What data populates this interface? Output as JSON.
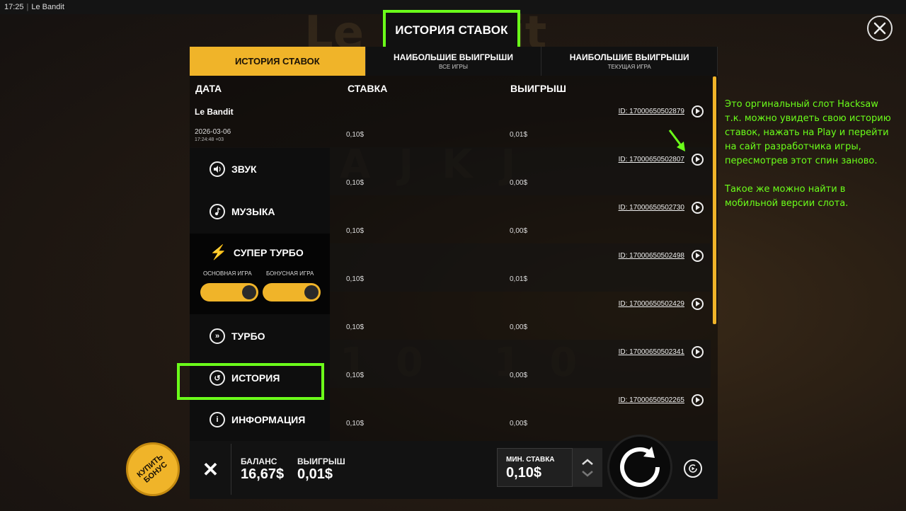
{
  "window": {
    "time": "17:25",
    "title": "Le Bandit"
  },
  "overlay_title": "ИСТОРИЯ СТАВОК",
  "tabs": [
    {
      "label": "ИСТОРИЯ СТАВОК",
      "sub": "",
      "active": true
    },
    {
      "label": "НАИБОЛЬШИЕ ВЫИГРЫШИ",
      "sub": "ВСЕ ИГРЫ",
      "active": false
    },
    {
      "label": "НАИБОЛЬШИЕ ВЫИГРЫШИ",
      "sub": "ТЕКУЩАЯ ИГРА",
      "active": false
    }
  ],
  "columns": {
    "date": "ДАТА",
    "bet": "СТАВКА",
    "win": "ВЫИГРЫШ"
  },
  "rows": [
    {
      "game": "Le Bandit",
      "date": "2026-03-06",
      "time": "17:24:48 +03",
      "bet": "0,10$",
      "win": "0,01$",
      "id": "ID: 17000650502879"
    },
    {
      "game": "",
      "date": "",
      "time": "",
      "bet": "0,10$",
      "win": "0,00$",
      "id": "ID: 17000650502807"
    },
    {
      "game": "",
      "date": "",
      "time": "",
      "bet": "0,10$",
      "win": "0,00$",
      "id": "ID: 17000650502730"
    },
    {
      "game": "",
      "date": "",
      "time": "",
      "bet": "0,10$",
      "win": "0,01$",
      "id": "ID: 17000650502498"
    },
    {
      "game": "",
      "date": "",
      "time": "",
      "bet": "0,10$",
      "win": "0,00$",
      "id": "ID: 17000650502429"
    },
    {
      "game": "",
      "date": "",
      "time": "",
      "bet": "0,10$",
      "win": "0,00$",
      "id": "ID: 17000650502341"
    },
    {
      "game": "",
      "date": "",
      "time": "",
      "bet": "0,10$",
      "win": "0,00$",
      "id": "ID: 17000650502265"
    }
  ],
  "menu": {
    "sound": "ЗВУК",
    "music": "МУЗЫКА",
    "super_turbo": "СУПЕР ТУРБО",
    "toggle_main": "ОСНОВНАЯ ИГРА",
    "toggle_bonus": "БОНУСНАЯ ИГРА",
    "turbo": "ТУРБО",
    "history": "ИСТОРИЯ",
    "info": "ИНФОРМАЦИЯ"
  },
  "bottom": {
    "close": "✕",
    "balance_label": "БАЛАНС",
    "balance_value": "16,67$",
    "win_label": "ВЫИГРЫШ",
    "win_value": "0,01$",
    "min_bet_label": "МИН. СТАВКА",
    "min_bet_value": "0,10$",
    "buy_bonus": "КУПИТЬ\nБОНУС"
  },
  "annotation": {
    "p1": "Это оргинальный слот  Hacksaw т.к. можно увидеть свою историю ставок, нажать на Play и перейти на сайт разработчика игры, пересмотрев этот спин заново.",
    "p2": "Такое же можно найти в мобильной версии слота."
  },
  "colors": {
    "accent": "#f0b429",
    "annotation": "#6bff1a"
  }
}
